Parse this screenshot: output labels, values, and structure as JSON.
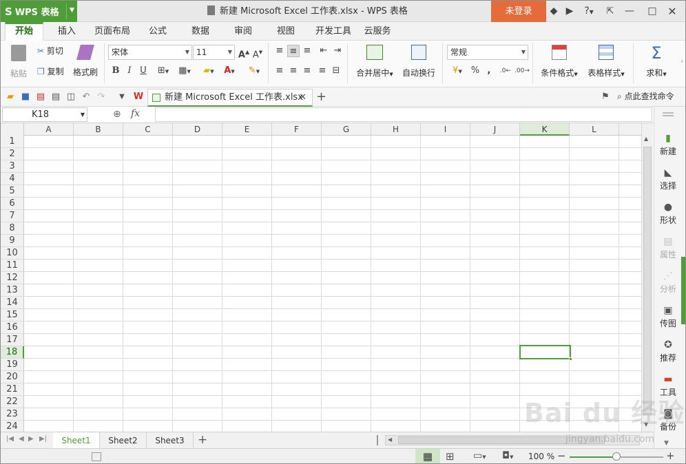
{
  "titlebar": {
    "app_button": "WPS 表格",
    "window_title": "新建 Microsoft Excel 工作表.xlsx - WPS 表格",
    "login_button": "未登录",
    "help_label": "?"
  },
  "ribbon_tabs": [
    "开始",
    "插入",
    "页面布局",
    "公式",
    "数据",
    "审阅",
    "视图",
    "开发工具",
    "云服务"
  ],
  "ribbon": {
    "paste": "粘贴",
    "cut": "剪切",
    "copy": "复制",
    "format_painter": "格式刷",
    "font_name": "宋体",
    "font_size": "11",
    "merge_center": "合并居中",
    "wrap_text": "自动换行",
    "number_format": "常规",
    "percent": "%",
    "comma": ",",
    "cond_format": "条件格式",
    "table_style": "表格样式",
    "sum": "求和"
  },
  "doc_tab": {
    "label": "新建 Microsoft Excel 工作表.xlsx",
    "find_command": "点此查找命令"
  },
  "formula_bar": {
    "name_box": "K18",
    "fx": "fx",
    "formula": ""
  },
  "grid": {
    "columns": [
      "A",
      "B",
      "C",
      "D",
      "E",
      "F",
      "G",
      "H",
      "I",
      "J",
      "K",
      "L"
    ],
    "rows": [
      "1",
      "2",
      "3",
      "4",
      "5",
      "6",
      "7",
      "8",
      "9",
      "10",
      "11",
      "12",
      "13",
      "14",
      "15",
      "16",
      "17",
      "18",
      "19",
      "20",
      "21",
      "22",
      "23",
      "24"
    ],
    "selected_column": "K",
    "selected_row": "18"
  },
  "sheets": [
    "Sheet1",
    "Sheet2",
    "Sheet3"
  ],
  "active_sheet": "Sheet1",
  "status": {
    "zoom": "100 %",
    "zoom_fraction": 0.5
  },
  "right_panel": [
    {
      "label": "新建",
      "icon": "new-icon",
      "disabled": false
    },
    {
      "label": "选择",
      "icon": "select-icon",
      "disabled": false
    },
    {
      "label": "形状",
      "icon": "shape-icon",
      "disabled": false
    },
    {
      "label": "属性",
      "icon": "property-icon",
      "disabled": true
    },
    {
      "label": "分析",
      "icon": "analysis-icon",
      "disabled": true
    },
    {
      "label": "传图",
      "icon": "upload-image-icon",
      "disabled": false
    },
    {
      "label": "推荐",
      "icon": "recommend-icon",
      "disabled": false
    },
    {
      "label": "工具",
      "icon": "toolbox-icon",
      "disabled": false
    },
    {
      "label": "备份",
      "icon": "backup-icon",
      "disabled": false
    }
  ],
  "watermark": {
    "main": "Bai du 经验",
    "sub": "jingyan.baidu.com"
  },
  "colors": {
    "accent": "#4e9d39",
    "login": "#e36c3a"
  }
}
